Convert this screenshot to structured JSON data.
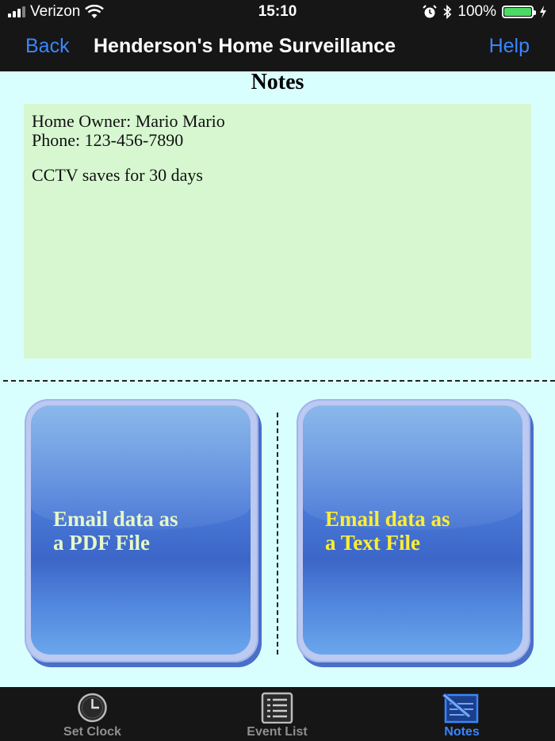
{
  "status_bar": {
    "carrier": "Verizon",
    "time": "15:10",
    "battery_percent": "100%",
    "battery_level": 1.0,
    "icons": [
      "signal-icon",
      "wifi-icon",
      "alarm-icon",
      "bluetooth-icon",
      "battery-icon",
      "charging-icon"
    ]
  },
  "nav": {
    "back_label": "Back",
    "title": "Henderson's Home Surveillance",
    "help_label": "Help"
  },
  "notes": {
    "heading": "Notes",
    "lines": [
      "Home Owner: Mario Mario",
      "Phone: 123-456-7890",
      "CCTV saves for 30 days"
    ]
  },
  "buttons": {
    "pdf": {
      "line1": "Email data as",
      "line2": "a PDF File",
      "text_color": "#e6f8c8"
    },
    "txt": {
      "line1": "Email data as",
      "line2": "a Text File",
      "text_color": "#ffee33"
    }
  },
  "tabs": [
    {
      "label": "Set Clock",
      "icon": "clock-icon",
      "active": false
    },
    {
      "label": "Event List",
      "icon": "list-icon",
      "active": false
    },
    {
      "label": "Notes",
      "icon": "notes-icon",
      "active": true
    }
  ],
  "colors": {
    "accent": "#3a86ff",
    "background": "#d9fefe",
    "notes_box": "#d7f7d1",
    "bar": "#161616"
  }
}
